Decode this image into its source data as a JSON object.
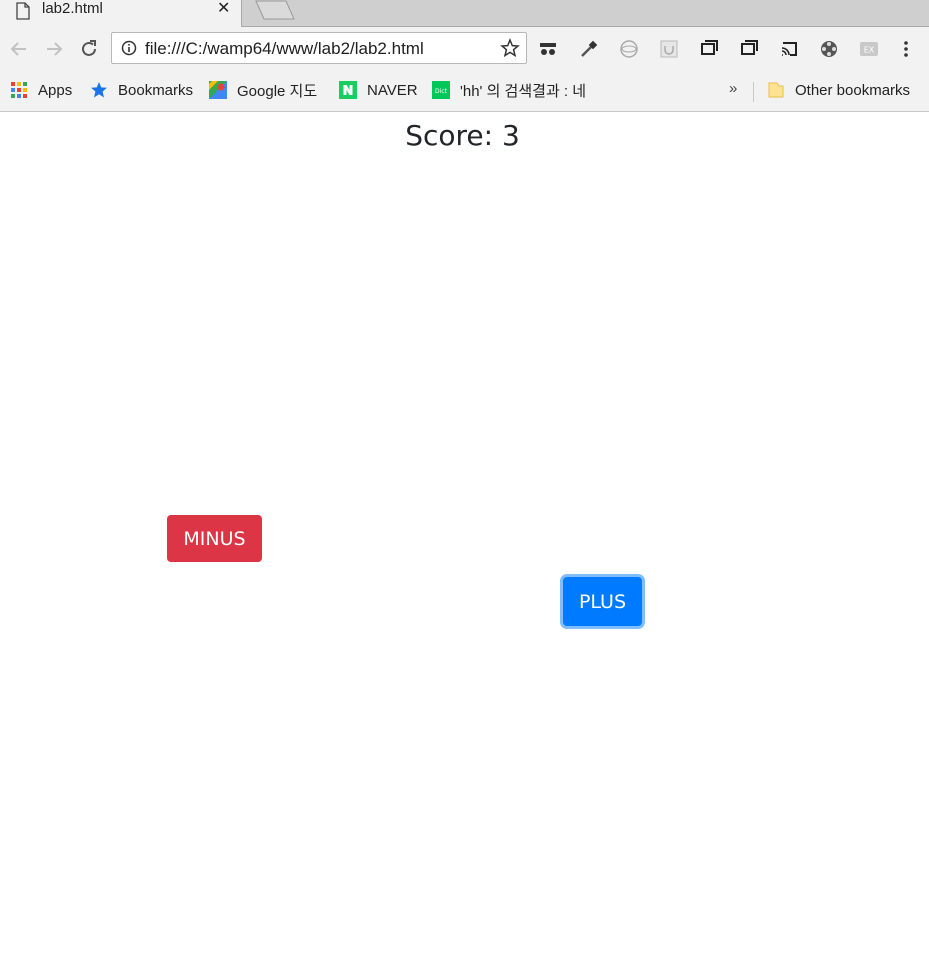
{
  "browser": {
    "tab": {
      "title": "lab2.html",
      "close_glyph": "✕"
    },
    "address": {
      "url": "file:///C:/wamp64/www/lab2/lab2.html"
    },
    "bookmarks": [
      {
        "label": "Apps",
        "icon": "apps-grid-icon"
      },
      {
        "label": "Bookmarks",
        "icon": "star-icon"
      },
      {
        "label": "Google 지도",
        "icon": "google-maps-icon"
      },
      {
        "label": "NAVER",
        "icon": "naver-icon"
      },
      {
        "label": "'hh' 의 검색결과 : 네",
        "icon": "dict-icon"
      }
    ],
    "overflow_label": "»",
    "other_bookmarks": "Other bookmarks"
  },
  "page": {
    "score_text": "Score: 3",
    "minus_label": "MINUS",
    "plus_label": "PLUS"
  },
  "colors": {
    "minus": "#dc3545",
    "plus": "#007bff"
  }
}
